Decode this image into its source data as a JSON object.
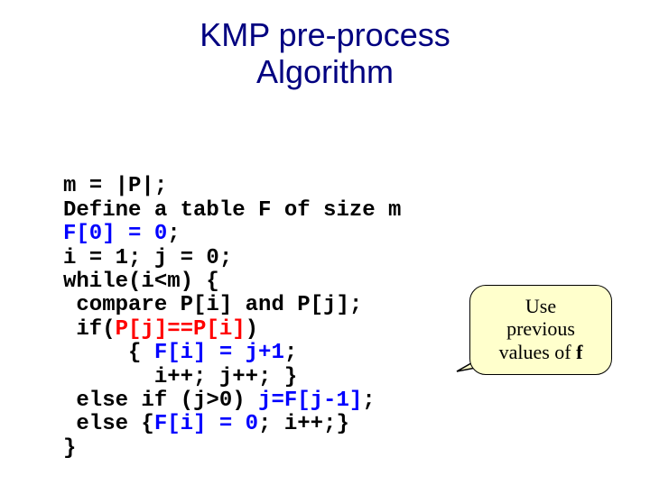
{
  "title_line1": "KMP pre-process",
  "title_line2": "Algorithm",
  "code": {
    "l1": "m = |P|;",
    "l2": "Define a table F of size m",
    "l3a": "F[0] = 0",
    "l3b": ";",
    "l4": "i = 1; j = 0;",
    "l5": "while(i<m) {",
    "l6": " compare P[i] and P[j];",
    "l7a": " if(",
    "l7b": "P[j]==P[i]",
    "l7c": ")",
    "l8a": "     { ",
    "l8b": "F[i] = j+1",
    "l8c": ";",
    "l9": "       i++; j++; }",
    "l10a": " else if (j>0) ",
    "l10b": "j=F[j-1]",
    "l10c": ";",
    "l11a": " else {",
    "l11b": "F[i] = 0",
    "l11c": "; i++;}",
    "l12": "}"
  },
  "callout": {
    "line1": "Use",
    "line2": "previous",
    "line3_pre": "values of ",
    "line3_f": "f"
  }
}
